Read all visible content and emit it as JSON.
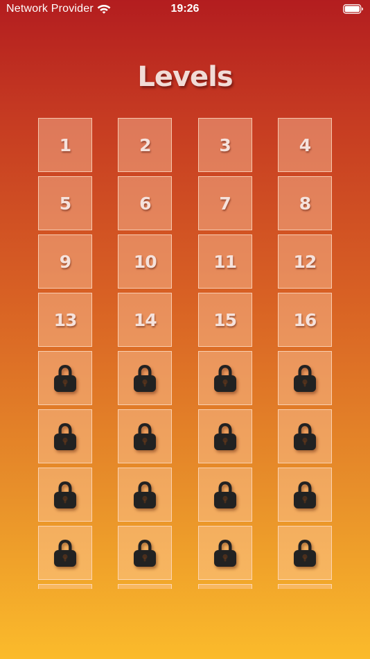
{
  "status_bar": {
    "carrier": "Network Provider",
    "time": "19:26"
  },
  "title": "Levels",
  "levels": [
    {
      "label": "1",
      "locked": false
    },
    {
      "label": "2",
      "locked": false
    },
    {
      "label": "3",
      "locked": false
    },
    {
      "label": "4",
      "locked": false
    },
    {
      "label": "5",
      "locked": false
    },
    {
      "label": "6",
      "locked": false
    },
    {
      "label": "7",
      "locked": false
    },
    {
      "label": "8",
      "locked": false
    },
    {
      "label": "9",
      "locked": false
    },
    {
      "label": "10",
      "locked": false
    },
    {
      "label": "11",
      "locked": false
    },
    {
      "label": "12",
      "locked": false
    },
    {
      "label": "13",
      "locked": false
    },
    {
      "label": "14",
      "locked": false
    },
    {
      "label": "15",
      "locked": false
    },
    {
      "label": "16",
      "locked": false
    },
    {
      "label": "",
      "locked": true
    },
    {
      "label": "",
      "locked": true
    },
    {
      "label": "",
      "locked": true
    },
    {
      "label": "",
      "locked": true
    },
    {
      "label": "",
      "locked": true
    },
    {
      "label": "",
      "locked": true
    },
    {
      "label": "",
      "locked": true
    },
    {
      "label": "",
      "locked": true
    },
    {
      "label": "",
      "locked": true
    },
    {
      "label": "",
      "locked": true
    },
    {
      "label": "",
      "locked": true
    },
    {
      "label": "",
      "locked": true
    },
    {
      "label": "",
      "locked": true
    },
    {
      "label": "",
      "locked": true
    },
    {
      "label": "",
      "locked": true
    },
    {
      "label": "",
      "locked": true
    },
    {
      "label": "",
      "locked": true
    },
    {
      "label": "",
      "locked": true
    },
    {
      "label": "",
      "locked": true
    },
    {
      "label": "",
      "locked": true
    }
  ],
  "icons": {
    "locked": "lock-icon",
    "wifi": "wifi-icon",
    "battery": "battery-icon"
  },
  "colors": {
    "gradient_top": "#b31d1f",
    "gradient_bottom": "#fbbb2b",
    "lock": "#222222",
    "title": "#f1dcd7"
  }
}
